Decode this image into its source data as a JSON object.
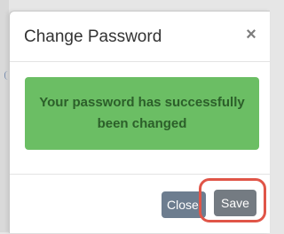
{
  "modal": {
    "title": "Change Password",
    "close_glyph": "×",
    "alert_message": "Your password has successfully been changed",
    "buttons": {
      "close_label": "Close",
      "save_label": "Save"
    }
  },
  "colors": {
    "alert_background": "#6bbe64",
    "alert_text": "#2c5f2a",
    "close_button": "#6d7d8f",
    "save_button": "#747b82",
    "highlight_ring": "#e05548"
  },
  "icons": {
    "dismiss": "close-icon"
  }
}
